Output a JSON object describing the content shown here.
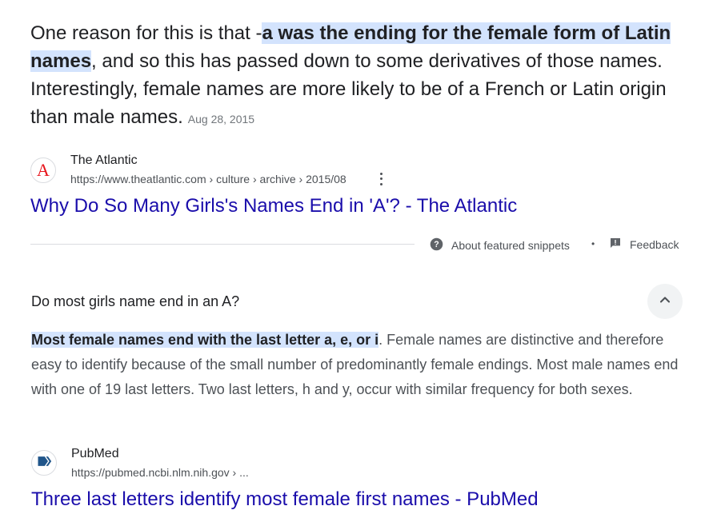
{
  "snippet": {
    "prefix": "One reason for this is that -",
    "highlight": "a was the ending for the female form of Latin names",
    "suffix": ", and so this has passed down to some derivatives of those names. Interestingly, female names are more likely to be of a French or Latin origin than male names.",
    "date": "Aug 28, 2015"
  },
  "source1": {
    "favicon_letter": "A",
    "name": "The Atlantic",
    "url": "https://www.theatlantic.com › culture › archive › 2015/08",
    "title": "Why Do So Many Girls's Names End in 'A'? - The Atlantic"
  },
  "footer": {
    "about_label": "About featured snippets",
    "separator": "•",
    "feedback_label": "Feedback"
  },
  "related": {
    "question": "Do most girls name end in an A?",
    "answer_highlight": "Most female names end with the last letter a, e, or i",
    "answer_rest": ". Female names are distinctive and therefore easy to identify because of the small number of predominantly female endings. Most male names end with one of 19 last letters. Two last letters, h and y, occur with similar frequency for both sexes.",
    "source": {
      "name": "PubMed",
      "url": "https://pubmed.ncbi.nlm.nih.gov › ...",
      "title": "Three last letters identify most female first names - PubMed"
    }
  },
  "colors": {
    "link": "#1a0dab",
    "highlight": "#d3e3fd",
    "atlantic_red": "#e7131a",
    "pubmed_blue": "#20558a"
  },
  "icons": {
    "atlantic": "atlantic-logo-icon",
    "more": "more-vert-icon",
    "help": "help-circle-icon",
    "feedback": "feedback-icon",
    "chevron": "chevron-up-icon",
    "pubmed": "pubmed-logo-icon"
  }
}
